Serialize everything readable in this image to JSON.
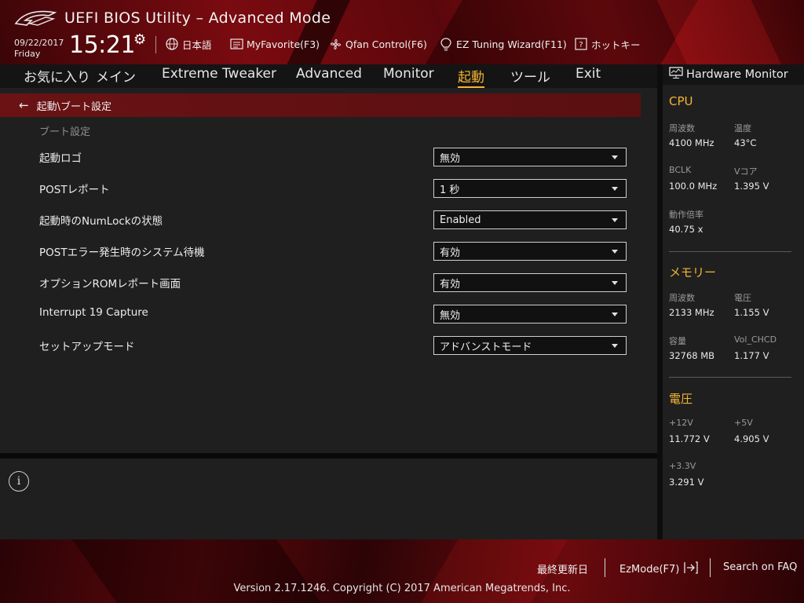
{
  "header": {
    "title": "UEFI BIOS Utility – Advanced Mode",
    "date": "09/22/2017",
    "weekday": "Friday",
    "time": "15:21",
    "tools": {
      "language": "日本語",
      "myfavorite": "MyFavorite(F3)",
      "qfan": "Qfan Control(F6)",
      "ez_tuning": "EZ Tuning Wizard(F11)",
      "hotkeys": "ホットキー"
    }
  },
  "menu": {
    "items": [
      "お気に入り",
      "メイン",
      "Extreme Tweaker",
      "Advanced",
      "Monitor",
      "起動",
      "ツール",
      "Exit"
    ],
    "active": "起動"
  },
  "main": {
    "breadcrumb": "起動\\ブート設定",
    "section_title": "ブート設定",
    "settings": [
      {
        "label": "起動ロゴ",
        "value": "無効"
      },
      {
        "label": "POSTレポート",
        "value": "1 秒"
      },
      {
        "label": "起動時のNumLockの状態",
        "value": "Enabled"
      },
      {
        "label": "POSTエラー発生時のシステム待機",
        "value": "有効"
      },
      {
        "label": "オプションROMレポート画面",
        "value": "有効"
      },
      {
        "label": "Interrupt 19 Capture",
        "value": "無効"
      },
      {
        "label": "セットアップモード",
        "value": "アドバンストモード"
      }
    ]
  },
  "hardware_monitor": {
    "title": "Hardware Monitor",
    "cpu": {
      "title": "CPU",
      "freq_label": "周波数",
      "freq": "4100 MHz",
      "temp_label": "温度",
      "temp": "43°C",
      "bclk_label": "BCLK",
      "bclk": "100.0 MHz",
      "vcore_label": "Vコア",
      "vcore": "1.395 V",
      "ratio_label": "動作倍率",
      "ratio": "40.75 x"
    },
    "memory": {
      "title": "メモリー",
      "freq_label": "周波数",
      "freq": "2133 MHz",
      "volt_label": "電圧",
      "volt": "1.155 V",
      "cap_label": "容量",
      "cap": "32768 MB",
      "volchcd_label": "Vol_CHCD",
      "volchcd": "1.177 V"
    },
    "voltage": {
      "title": "電圧",
      "v12_label": "+12V",
      "v12": "11.772 V",
      "v5_label": "+5V",
      "v5": "4.905 V",
      "v33_label": "+3.3V",
      "v33": "3.291 V"
    }
  },
  "footer": {
    "last_modified": "最終更新日",
    "ezmode": "EzMode(F7)",
    "faq": "Search on FAQ",
    "copyright": "Version 2.17.1246. Copyright (C) 2017 American Megatrends, Inc."
  },
  "colors": {
    "accent": "#f4b434",
    "brand_red": "#7a0b10",
    "panel": "#1f1f1f"
  }
}
